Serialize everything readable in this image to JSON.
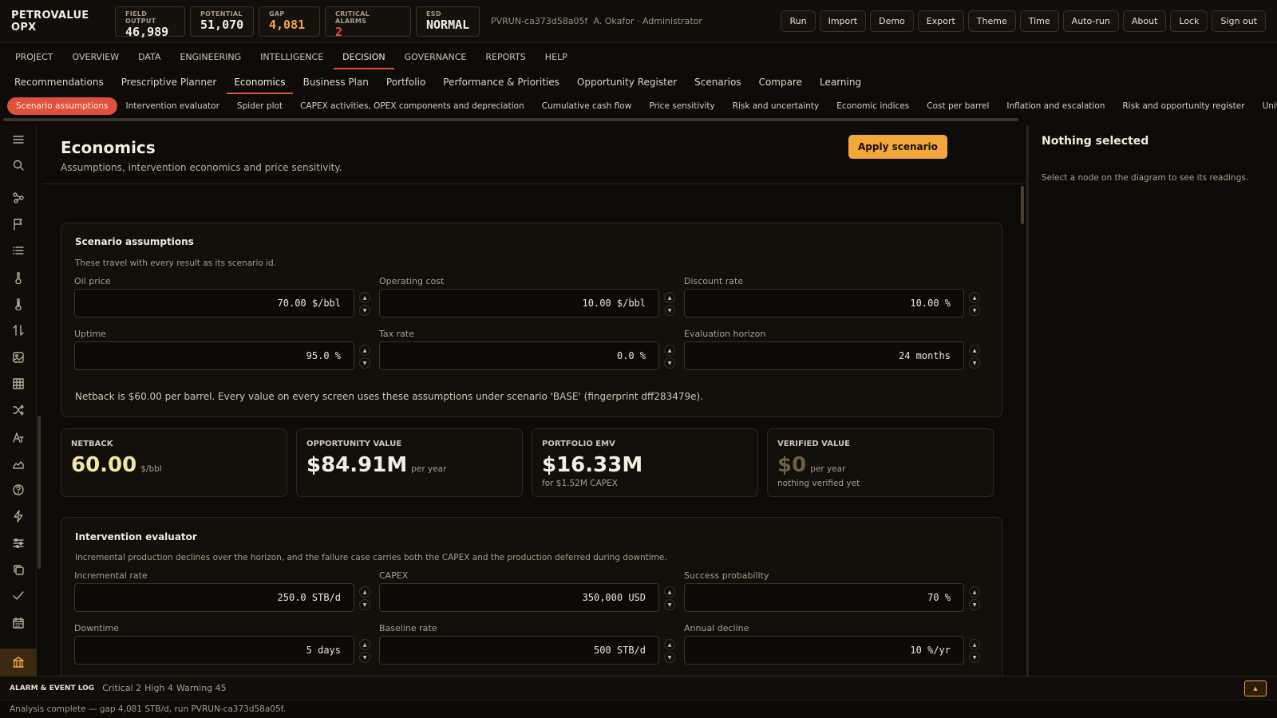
{
  "header": {
    "brand": "PETROVALUE OPX",
    "kpis": [
      {
        "label": "FIELD OUTPUT",
        "value": "46,989"
      },
      {
        "label": "POTENTIAL",
        "value": "51,070"
      },
      {
        "label": "GAP",
        "value": "4,081"
      },
      {
        "label": "CRITICAL ALARMS",
        "value": "2"
      },
      {
        "label": "ESD",
        "value": "NORMAL"
      }
    ],
    "run_id": "PVRUN-ca373d58a05f",
    "user": "A. Okafor · Administrator",
    "buttons": [
      "Run",
      "Import",
      "Demo",
      "Export",
      "Theme",
      "Time",
      "Auto-run",
      "About",
      "Lock",
      "Sign out"
    ]
  },
  "main_nav": [
    "PROJECT",
    "OVERVIEW",
    "DATA",
    "ENGINEERING",
    "INTELLIGENCE",
    "DECISION",
    "GOVERNANCE",
    "REPORTS",
    "HELP"
  ],
  "main_nav_active": "DECISION",
  "sub_nav": [
    "Recommendations",
    "Prescriptive Planner",
    "Economics",
    "Business Plan",
    "Portfolio",
    "Performance & Priorities",
    "Opportunity Register",
    "Scenarios",
    "Compare",
    "Learning"
  ],
  "sub_nav_active": "Economics",
  "section_tabs": [
    "Scenario assumptions",
    "Intervention evaluator",
    "Spider plot",
    "CAPEX activities, OPEX components and depreciation",
    "Cumulative cash flow",
    "Price sensitivity",
    "Risk and uncertainty",
    "Economic indices",
    "Cost per barrel",
    "Inflation and escalation",
    "Risk and opportunity register",
    "Units-of-production deprec"
  ],
  "section_tabs_active": "Scenario assumptions",
  "rail_icons": [
    "menu-icon",
    "search-icon",
    "nodes-icon",
    "flag-icon",
    "list-icon",
    "thermometer-icon",
    "thermometer-alt-icon",
    "transfer-icon",
    "image-icon",
    "table-icon",
    "shuffle-icon",
    "typography-icon",
    "area-chart-icon",
    "help-icon",
    "lightning-icon",
    "sliders-icon",
    "copy-icon",
    "check-icon",
    "calendar-icon",
    "bank-icon"
  ],
  "page": {
    "title": "Economics",
    "subtitle": "Assumptions, intervention economics and price sensitivity.",
    "apply_button": "Apply scenario"
  },
  "scenario": {
    "title": "Scenario assumptions",
    "description": "These travel with every result as its scenario id.",
    "fields": [
      {
        "label": "Oil price",
        "value": "70.00 $/bbl"
      },
      {
        "label": "Operating cost",
        "value": "10.00 $/bbl"
      },
      {
        "label": "Discount rate",
        "value": "10.00 %"
      },
      {
        "label": "Uptime",
        "value": "95.0 %"
      },
      {
        "label": "Tax rate",
        "value": "0.0 %"
      },
      {
        "label": "Evaluation horizon",
        "value": "24 months"
      }
    ],
    "note": "Netback is $60.00 per barrel. Every value on every screen uses these assumptions under scenario 'BASE' (fingerprint dff283479e)."
  },
  "metrics": [
    {
      "label": "NETBACK",
      "value": "60.00",
      "unit": "$/bbl",
      "foot": ""
    },
    {
      "label": "OPPORTUNITY VALUE",
      "value": "$84.91M",
      "unit": "per year",
      "foot": ""
    },
    {
      "label": "PORTFOLIO EMV",
      "value": "$16.33M",
      "unit": "",
      "foot": "for $1.52M CAPEX"
    },
    {
      "label": "VERIFIED VALUE",
      "value": "$0",
      "unit": "per year",
      "foot": "nothing verified yet"
    }
  ],
  "intervention": {
    "title": "Intervention evaluator",
    "description": "Incremental production declines over the horizon, and the failure case carries both the CAPEX and the production deferred during downtime.",
    "fields": [
      {
        "label": "Incremental rate",
        "value": "250.0 STB/d"
      },
      {
        "label": "CAPEX",
        "value": "350,000 USD"
      },
      {
        "label": "Success probability",
        "value": "70 %"
      },
      {
        "label": "Downtime",
        "value": "5 days"
      },
      {
        "label": "Baseline rate",
        "value": "500 STB/d"
      },
      {
        "label": "Annual decline",
        "value": "10 %/yr"
      }
    ]
  },
  "right_panel": {
    "title": "Nothing selected",
    "text": "Select a node on the diagram to see its readings."
  },
  "alarm_bar": {
    "title": "ALARM & EVENT LOG",
    "counts": [
      "Critical 2",
      "High 4",
      "Warning 45"
    ]
  },
  "status_text": "Analysis complete — gap 4,081 STB/d, run PVRUN-ca373d58a05f.",
  "colors": {
    "accent": "#f2a73a",
    "critical": "#e0503a",
    "background": "#0d0b08"
  }
}
